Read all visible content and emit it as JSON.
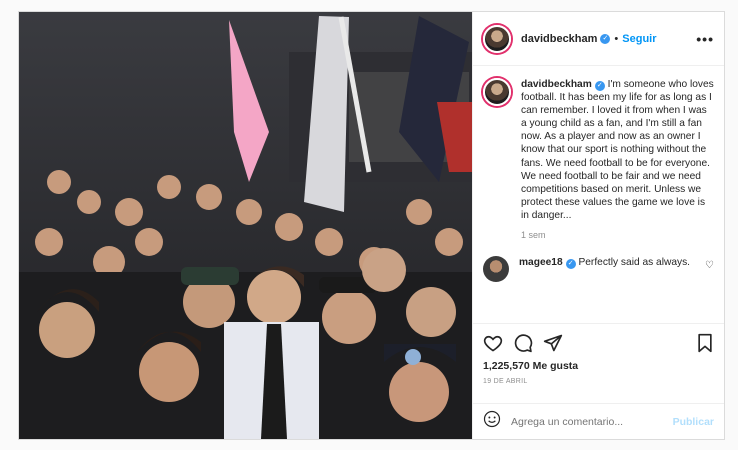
{
  "post": {
    "username": "davidbeckham",
    "follow_label": "Seguir",
    "more_label": "•••",
    "photo_alt": "Group photo of fans with David Beckham",
    "caption": {
      "username": "davidbeckham",
      "text": "I'm someone who loves football. It has been my life for as long as I can remember. I loved it from when I was a young child as a fan, and I'm still a fan now. As a player and now as an owner I know that our sport is nothing without the fans. We need football to be for everyone. We need football to be fair and we need competitions based on merit. Unless we protect these values the game we love is in danger...",
      "time": "1 sem"
    },
    "reply": {
      "username": "magee18",
      "text": "Perfectly said as always."
    },
    "likes_count": "1,225,570",
    "likes_label": "Me gusta",
    "date": "19 DE ABRIL",
    "comment_placeholder": "Agrega un comentario...",
    "publish_label": "Publicar"
  },
  "colors": {
    "accent": "#0095f6",
    "verified": "#3897f0",
    "publish_disabled": "#b2dffc",
    "photo_dark": "#2a2a2e"
  },
  "icons": [
    "like-icon",
    "comment-icon",
    "share-icon",
    "save-icon",
    "emoji-icon",
    "verified-icon",
    "more-icon"
  ]
}
